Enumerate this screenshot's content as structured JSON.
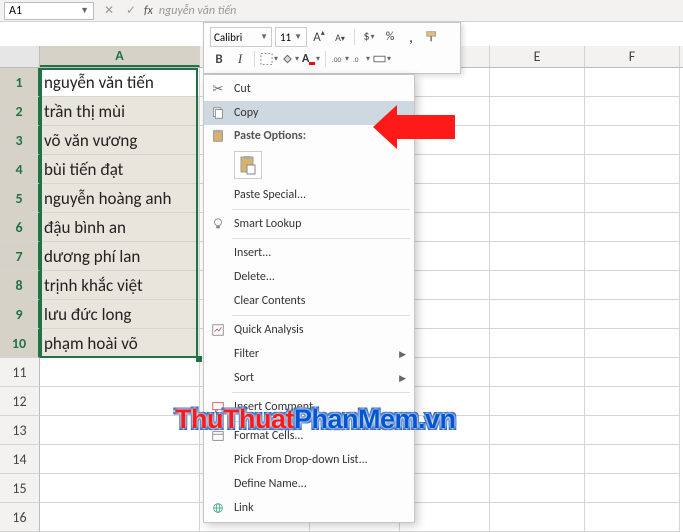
{
  "nameBox": "A1",
  "formulaBar": "nguyễn văn tiến",
  "miniToolbar": {
    "fontName": "Calibri",
    "fontSize": "11",
    "incFont": "A",
    "decFont": "A",
    "currency": "$",
    "percent": "%",
    "comma": ",",
    "bold": "B",
    "italic": "I",
    "fontColorLetter": "A"
  },
  "columns": [
    "A",
    "B",
    "C",
    "D",
    "E",
    "F"
  ],
  "rows": [
    "1",
    "2",
    "3",
    "4",
    "5",
    "6",
    "7",
    "8",
    "9",
    "10",
    "11",
    "12",
    "13",
    "14",
    "15",
    "16"
  ],
  "data": {
    "A": [
      "nguyễn văn tiến",
      "trần thị mùi",
      "võ văn vương",
      "bùi tiến đạt",
      "nguyễn hoàng anh",
      "đậu bình an",
      "dương phí lan",
      "trịnh khắc việt",
      "lưu đức long",
      "phạm hoài võ"
    ]
  },
  "contextMenu": {
    "cut": "Cut",
    "copy": "Copy",
    "pasteOptionsHeading": "Paste Options:",
    "pasteSpecial": "Paste Special...",
    "smartLookup": "Smart Lookup",
    "insert": "Insert...",
    "delete": "Delete...",
    "clearContents": "Clear Contents",
    "quickAnalysis": "Quick Analysis",
    "filter": "Filter",
    "sort": "Sort",
    "insertComment": "Insert Comment",
    "formatCells": "Format Cells...",
    "pickList": "Pick From Drop-down List...",
    "defineName": "Define Name...",
    "link": "Link"
  },
  "watermark": {
    "p1": "ThuThuat",
    "p2": "PhanMem.vn"
  }
}
